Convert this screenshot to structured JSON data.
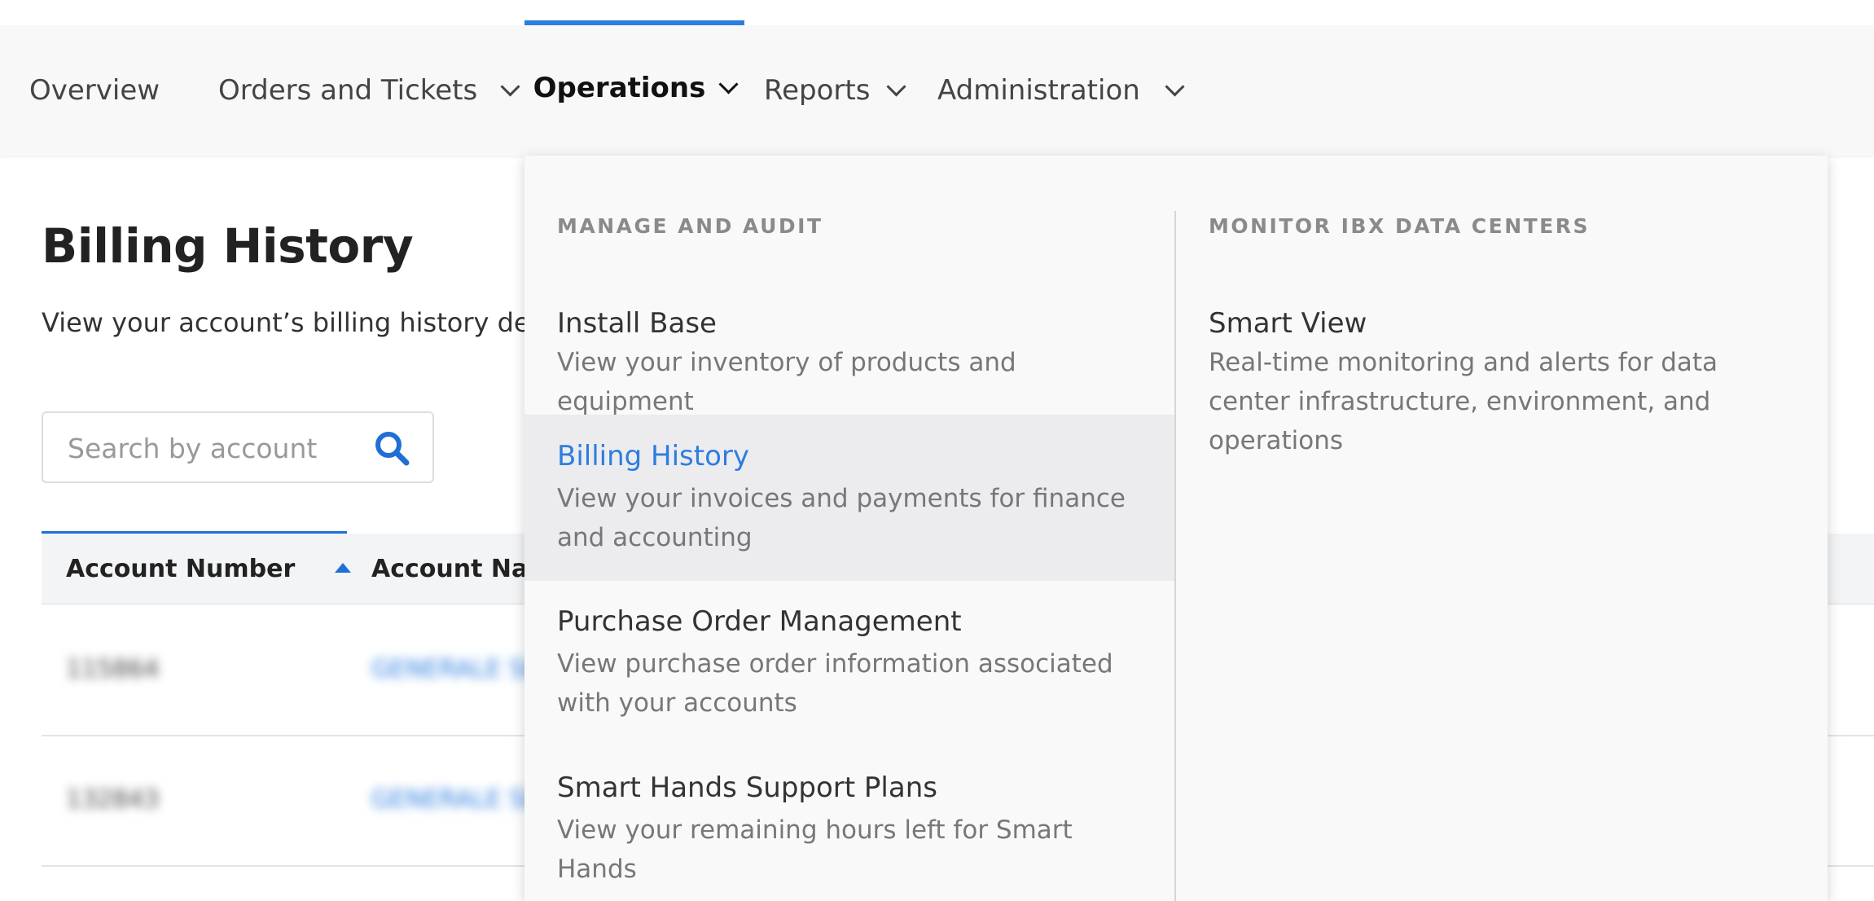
{
  "nav": {
    "items": [
      {
        "label": "Overview"
      },
      {
        "label": "Orders and Tickets"
      },
      {
        "label": "Operations"
      },
      {
        "label": "Reports"
      },
      {
        "label": "Administration"
      }
    ],
    "active": "Operations",
    "accent_color": "#2d7de0"
  },
  "page": {
    "title": "Billing History",
    "subtitle": "View your account’s billing history de"
  },
  "search": {
    "placeholder": "Search by account"
  },
  "table": {
    "columns": [
      {
        "label": "Account Number",
        "sort": "ascending"
      },
      {
        "label": "Account Nam"
      }
    ],
    "rows": [
      {
        "account_number": "115864",
        "account_name": "GENERALE SE"
      },
      {
        "account_number": "132843",
        "account_name": "GENERALE SE"
      }
    ]
  },
  "menu": {
    "manage_heading": "MANAGE AND AUDIT",
    "monitor_heading": "MONITOR IBX DATA CENTERS",
    "manage_items": [
      {
        "title": "Install Base",
        "description": "View your inventory of products and equipment"
      },
      {
        "title": "Billing History",
        "description": "View your invoices and payments for finance and accounting"
      },
      {
        "title": "Purchase Order Management",
        "description": "View purchase order information associated with your accounts"
      },
      {
        "title": "Smart Hands Support Plans",
        "description": "View your remaining hours left for Smart Hands"
      }
    ],
    "monitor_items": [
      {
        "title": "Smart View",
        "description": "Real-time monitoring and alerts for data center infrastructure, environment, and operations"
      }
    ]
  }
}
